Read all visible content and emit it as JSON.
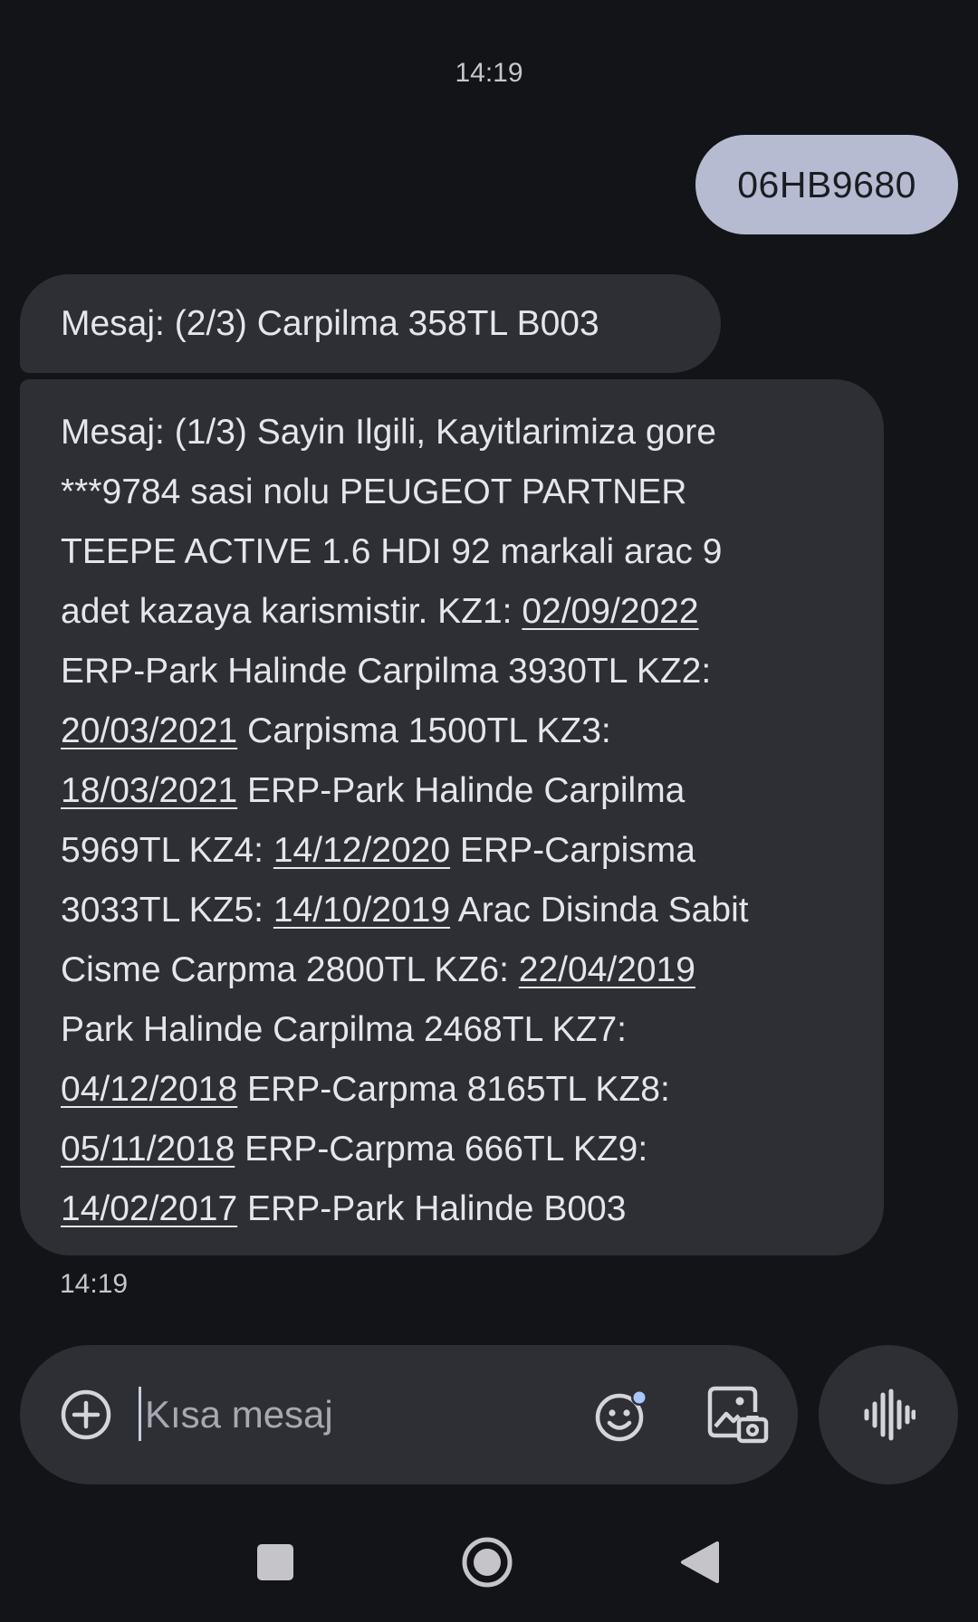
{
  "conversation": {
    "time_top": "14:19",
    "time_bottom": "14:19",
    "sent_message": "06HB9680",
    "received_short": "Mesaj: (2/3) Carpilma 358TL  B003",
    "received_long_lines": [
      [
        {
          "t": "Mesaj: (1/3) Sayin Ilgili, Kayitlarimiza gore"
        }
      ],
      [
        {
          "t": "***9784 sasi nolu PEUGEOT PARTNER"
        }
      ],
      [
        {
          "t": "TEEPE ACTIVE 1.6 HDI 92 markali arac 9"
        }
      ],
      [
        {
          "t": "adet kazaya karismistir. KZ1: "
        },
        {
          "t": "02/09/2022",
          "link": true
        }
      ],
      [
        {
          "t": "ERP-Park Halinde Carpilma 3930TL KZ2:"
        }
      ],
      [
        {
          "t": "20/03/2021",
          "link": true
        },
        {
          "t": " Carpisma 1500TL KZ3:"
        }
      ],
      [
        {
          "t": "18/03/2021",
          "link": true
        },
        {
          "t": " ERP-Park Halinde Carpilma"
        }
      ],
      [
        {
          "t": "5969TL KZ4: "
        },
        {
          "t": "14/12/2020",
          "link": true
        },
        {
          "t": " ERP-Carpisma"
        }
      ],
      [
        {
          "t": "3033TL KZ5: "
        },
        {
          "t": "14/10/2019",
          "link": true
        },
        {
          "t": " Arac Disinda Sabit"
        }
      ],
      [
        {
          "t": "Cisme Carpma 2800TL KZ6: "
        },
        {
          "t": "22/04/2019",
          "link": true
        }
      ],
      [
        {
          "t": "Park Halinde Carpilma 2468TL KZ7:"
        }
      ],
      [
        {
          "t": "04/12/2018",
          "link": true
        },
        {
          "t": " ERP-Carpma 8165TL KZ8:"
        }
      ],
      [
        {
          "t": "05/11/2018",
          "link": true
        },
        {
          "t": " ERP-Carpma 666TL KZ9:"
        }
      ],
      [
        {
          "t": "14/02/2017",
          "link": true
        },
        {
          "t": " ERP-Park Halinde  B003"
        }
      ]
    ]
  },
  "compose": {
    "placeholder": "Kısa mesaj",
    "icons": {
      "attach": "plus-circle-icon",
      "emoji": "emoji-icon",
      "gallery": "gallery-icon",
      "voice": "voice-waveform-icon"
    }
  },
  "navigation": {
    "icons": [
      "recents-square-icon",
      "home-circle-icon",
      "back-triangle-icon"
    ]
  },
  "colors": {
    "background": "#131418",
    "bubble_received": "#2d2f35",
    "bubble_sent": "#b6bbd1",
    "emoji_badge": "#a8c7fa"
  }
}
